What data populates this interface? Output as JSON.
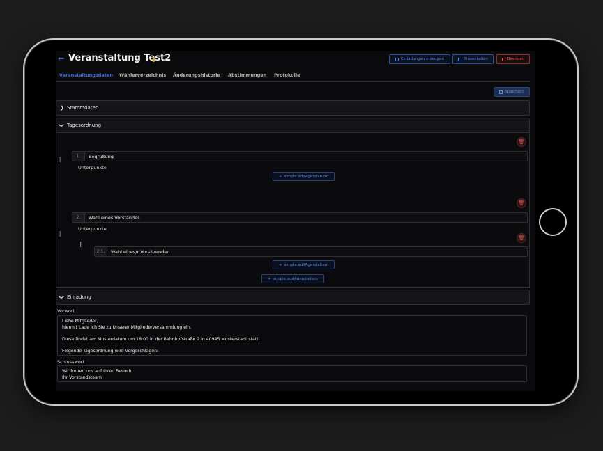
{
  "header": {
    "back": "←",
    "title": "Veranstaltung Test2",
    "buttons": {
      "invitations": "Einladungen erzeugen",
      "presentation": "Präsentation",
      "end": "Beenden"
    }
  },
  "tabs": [
    "Veranstaltungsdaten",
    "Wählerverzeichnis",
    "Änderungshistorie",
    "Abstimmungen",
    "Protokolle"
  ],
  "save_label": "Speichern",
  "sections": {
    "stammdaten": "Stammdaten",
    "tagesordnung": "Tagesordnung",
    "einladung": "Einladung"
  },
  "agenda": {
    "items": [
      {
        "num": "1.",
        "title": "Begrüßung"
      },
      {
        "num": "2.",
        "title": "Wahl eines Vorstandes"
      }
    ],
    "subitems": [
      {
        "num": "2.1.",
        "title": "Wahl eines/r Vorsitzenden"
      }
    ],
    "sub_label": "Unterpunkte",
    "add_label": "simple.addAgendaItem"
  },
  "invitation": {
    "vorwort_label": "Vorwort",
    "vorwort_lines": [
      "Liebe Mitglieder,",
      "hiermit Lade ich Sie zu Unserer Mitgliederversammlung ein.",
      "",
      "Diese findet am Musterdatum um 18:00 in der Bahnhofstraße 2 in 40945 Musterstadt statt.",
      "",
      "Folgende Tagesordnung wird Vorgeschlagen:"
    ],
    "schlusswort_label": "Schlusswort",
    "schlusswort_lines": [
      "Wir freuen uns auf Ihren Besuch!",
      "Ihr Vorstandsteam"
    ]
  },
  "icons": {
    "trash": "trash-icon",
    "drag": "drag-handle-icon",
    "chevron": "chevron-icon"
  },
  "colors": {
    "accent": "#3e6ed6",
    "danger": "#e25555",
    "background": "#0b0b0d"
  }
}
